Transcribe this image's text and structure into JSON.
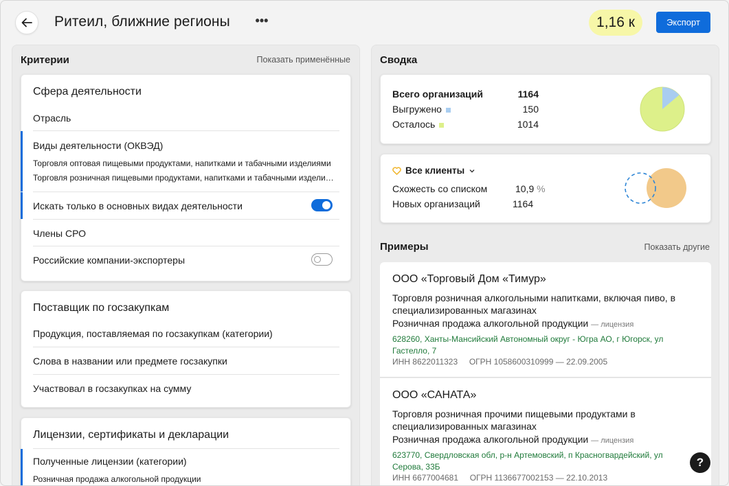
{
  "header": {
    "title": "Ритеил, ближние регионы",
    "more_label": "•••",
    "count": "1,16 к",
    "export_label": "Экспорт"
  },
  "criteria": {
    "title": "Критерии",
    "show_applied": "Показать применённые",
    "activity": {
      "title": "Сфера деятельности",
      "industry": "Отрасль",
      "okved_label": "Виды деятельности (ОКВЭД)",
      "okved_items": [
        "Торговля оптовая пищевыми продуктами, напитками и табачными изделиями",
        "Торговля розничная пищевыми продуктами, напитками и табачными изделиями"
      ],
      "main_only_label": "Искать только в основных видах деятельности",
      "main_only_on": true,
      "sro_label": "Члены СРО",
      "exporters_label": "Российские компании-экспортеры",
      "exporters_on": false
    },
    "procurement": {
      "title": "Поставщик по госзакупкам",
      "products": "Продукция, поставляемая по госзакупкам (категории)",
      "words": "Слова в названии или предмете госзакупки",
      "amount": "Участвовал в госзакупках на сумму"
    },
    "licenses": {
      "title": "Лицензии, сертификаты и декларации",
      "received_label": "Полученные лицензии (категории)",
      "received_value": "Розничная продажа алкогольной продукции"
    }
  },
  "summary": {
    "title": "Сводка",
    "total_label": "Всего организаций",
    "total_value": "1164",
    "exported_label": "Выгружено",
    "exported_value": "150",
    "remaining_label": "Осталось",
    "remaining_value": "1014",
    "colors": {
      "exported": "#a9cdf0",
      "remaining": "#ddf08a"
    }
  },
  "clients": {
    "selector_label": "Все клиенты",
    "similarity_label": "Схожесть со списком",
    "similarity_value": "10,9",
    "similarity_unit": "%",
    "new_label": "Новых организаций",
    "new_value": "1164",
    "colors": {
      "heart": "#f0b429",
      "circle": "#f2c98a",
      "dashed": "#2f86d6"
    }
  },
  "examples": {
    "title": "Примеры",
    "show_other": "Показать другие",
    "items": [
      {
        "name": "ООО «Торговый Дом «Тимур»",
        "activity": "Торговля розничная алкогольными напитками, включая пиво, в специализированных магазинах",
        "license": "Розничная продажа алкогольной продукции",
        "license_tag": "— лицензия",
        "address": "628260, Ханты-Мансийский Автономный округ - Югра АО, г Югорск, ул Гастелло, 7",
        "inn": "ИНН 8622011323",
        "ogrn": "ОГРН 1058600310999 — 22.09.2005"
      },
      {
        "name": "ООО «САНАТА»",
        "activity": "Торговля розничная прочими пищевыми продуктами в специализированных магазинах",
        "license": "Розничная продажа алкогольной продукции",
        "license_tag": "— лицензия",
        "address": "623770, Свердловская обл, р-н Артемовский, п Красногвардейский, ул Серова, 33Б",
        "inn": "ИНН 6677004681",
        "ogrn": "ОГРН 1136677002153 — 22.10.2013"
      }
    ]
  },
  "help_label": "?",
  "accent_color": "#0f6cdb"
}
